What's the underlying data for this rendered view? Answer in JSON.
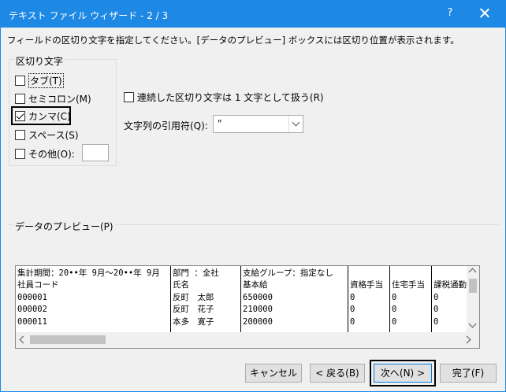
{
  "window": {
    "title": "テキスト ファイル ウィザード - 2 / 3",
    "help": "?"
  },
  "instruction": "フィールドの区切り文字を指定してください。[データのプレビュー] ボックスには区切り位置が表示されます。",
  "delimiters": {
    "group_label": "区切り文字",
    "tab": {
      "label": "タブ(T)",
      "checked": false
    },
    "semicolon": {
      "label": "セミコロン(M)",
      "checked": false
    },
    "comma": {
      "label": "カンマ(C)",
      "checked": true
    },
    "space": {
      "label": "スペース(S)",
      "checked": false
    },
    "other": {
      "label": "その他(O):",
      "checked": false,
      "value": ""
    }
  },
  "consecutive": {
    "label": "連続した区切り文字は 1 文字として扱う(R)",
    "checked": false
  },
  "text_qualifier": {
    "label": "文字列の引用符(Q):",
    "value": "\""
  },
  "preview": {
    "label": "データのプレビュー(P)",
    "columns": [
      {
        "rows": [
          "集計期間：20••年 9月～20••年 9月",
          "社員コード",
          "000001",
          "000002",
          "000011"
        ]
      },
      {
        "rows": [
          "部門  ：全社",
          "氏名",
          "反町　太郎",
          "反町　花子",
          "本多　寛子"
        ]
      },
      {
        "rows": [
          "支給グループ：指定なし",
          "基本給",
          "650000",
          "210000",
          "200000"
        ]
      },
      {
        "rows": [
          "",
          "資格手当",
          "0",
          "0",
          "0"
        ]
      },
      {
        "rows": [
          "",
          "住宅手当",
          "0",
          "0",
          "0"
        ]
      },
      {
        "rows": [
          "",
          "課税通勤費",
          "0",
          "0",
          "0"
        ]
      }
    ]
  },
  "buttons": {
    "cancel": "キャンセル",
    "back": "< 戻る(B)",
    "next": "次へ(N) >",
    "finish": "完了(F)"
  }
}
